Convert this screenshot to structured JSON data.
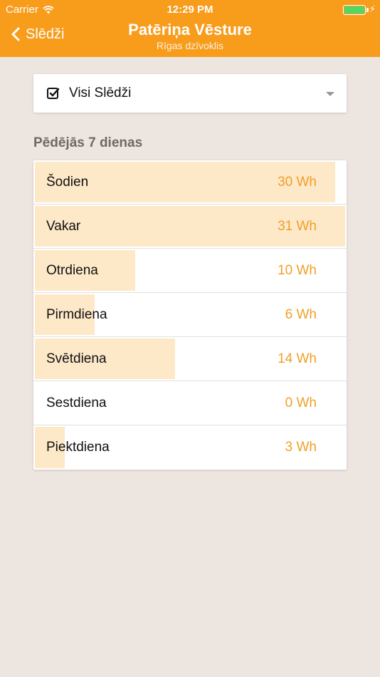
{
  "status_bar": {
    "carrier": "Carrier",
    "time": "12:29 PM"
  },
  "nav": {
    "back_label": "Slēdži",
    "title": "Patēriņa Vēsture",
    "subtitle": "Rīgas dzīvoklis"
  },
  "filter": {
    "selected": "Visi Slēdži"
  },
  "section": {
    "title": "Pēdējās 7 dienas"
  },
  "colors": {
    "accent": "#f89c1c",
    "bar": "#fde8c8",
    "value": "#f0a028",
    "background": "#ede5e0"
  },
  "days": [
    {
      "label": "Šodien",
      "value": "30 Wh",
      "wh": 30
    },
    {
      "label": "Vakar",
      "value": "31 Wh",
      "wh": 31
    },
    {
      "label": "Otrdiena",
      "value": "10 Wh",
      "wh": 10
    },
    {
      "label": "Pirmdiena",
      "value": "6 Wh",
      "wh": 6
    },
    {
      "label": "Svētdiena",
      "value": "14 Wh",
      "wh": 14
    },
    {
      "label": "Sestdiena",
      "value": "0 Wh",
      "wh": 0
    },
    {
      "label": "Piektdiena",
      "value": "3 Wh",
      "wh": 3
    }
  ]
}
